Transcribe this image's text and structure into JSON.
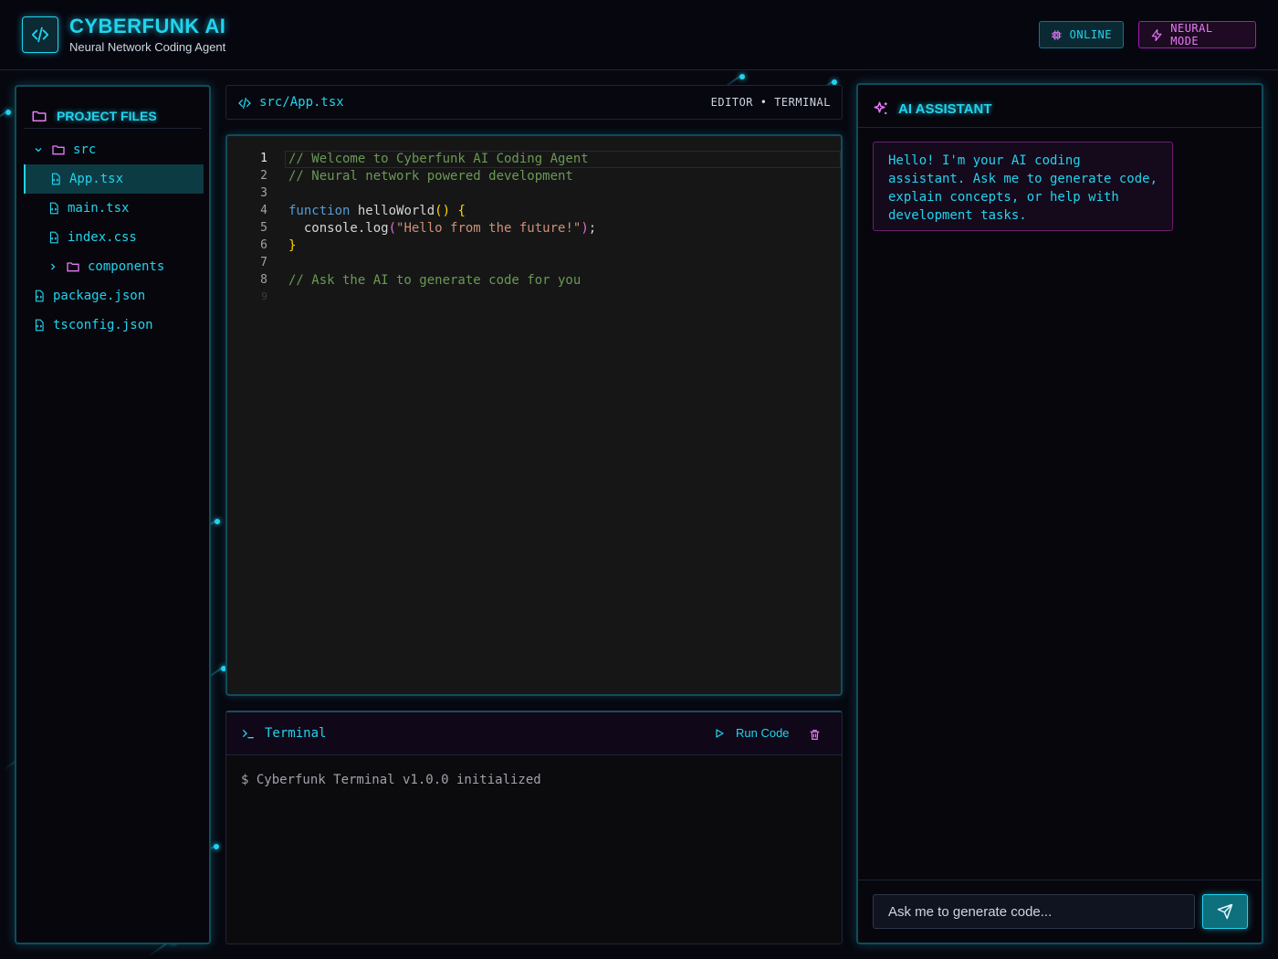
{
  "header": {
    "title": "CYBERFUNK AI",
    "subtitle": "Neural Network Coding Agent",
    "online_label": "ONLINE",
    "neural_label": "NEURAL MODE"
  },
  "files": {
    "title": "PROJECT FILES",
    "items": [
      {
        "label": "src",
        "type": "folder"
      },
      {
        "label": "App.tsx",
        "type": "file"
      },
      {
        "label": "main.tsx",
        "type": "file"
      },
      {
        "label": "index.css",
        "type": "file"
      },
      {
        "label": "components",
        "type": "folder"
      },
      {
        "label": "package.json",
        "type": "file"
      },
      {
        "label": "tsconfig.json",
        "type": "file"
      }
    ]
  },
  "editor": {
    "path": "src/App.tsx",
    "mode": "EDITOR • TERMINAL",
    "line_numbers": [
      "1",
      "2",
      "3",
      "4",
      "5",
      "6",
      "7",
      "8",
      "9"
    ],
    "code": {
      "l1": "// Welcome to Cyberfunk AI Coding Agent",
      "l2": "// Neural network powered development",
      "l4_kw": "function",
      "l4_fn": " helloWorld",
      "l4_paren": "()",
      "l4_brace": " {",
      "l5_plain": "  console.log",
      "l5_open": "(",
      "l5_str": "\"Hello from the future!\"",
      "l5_close": ")",
      "l5_semi": ";",
      "l6_brace": "}",
      "l8": "// Ask the AI to generate code for you"
    }
  },
  "terminal": {
    "title": "Terminal",
    "run_label": "Run Code",
    "output": "$ Cyberfunk Terminal v1.0.0 initialized"
  },
  "assistant": {
    "title": "AI ASSISTANT",
    "greeting": "Hello! I'm your AI coding assistant. Ask me to generate code, explain concepts, or help with development tasks.",
    "input_placeholder": "Ask me to generate code..."
  },
  "colors": {
    "accent": "#22d3ee",
    "secondary": "#e879f9",
    "background": "#07070f"
  }
}
